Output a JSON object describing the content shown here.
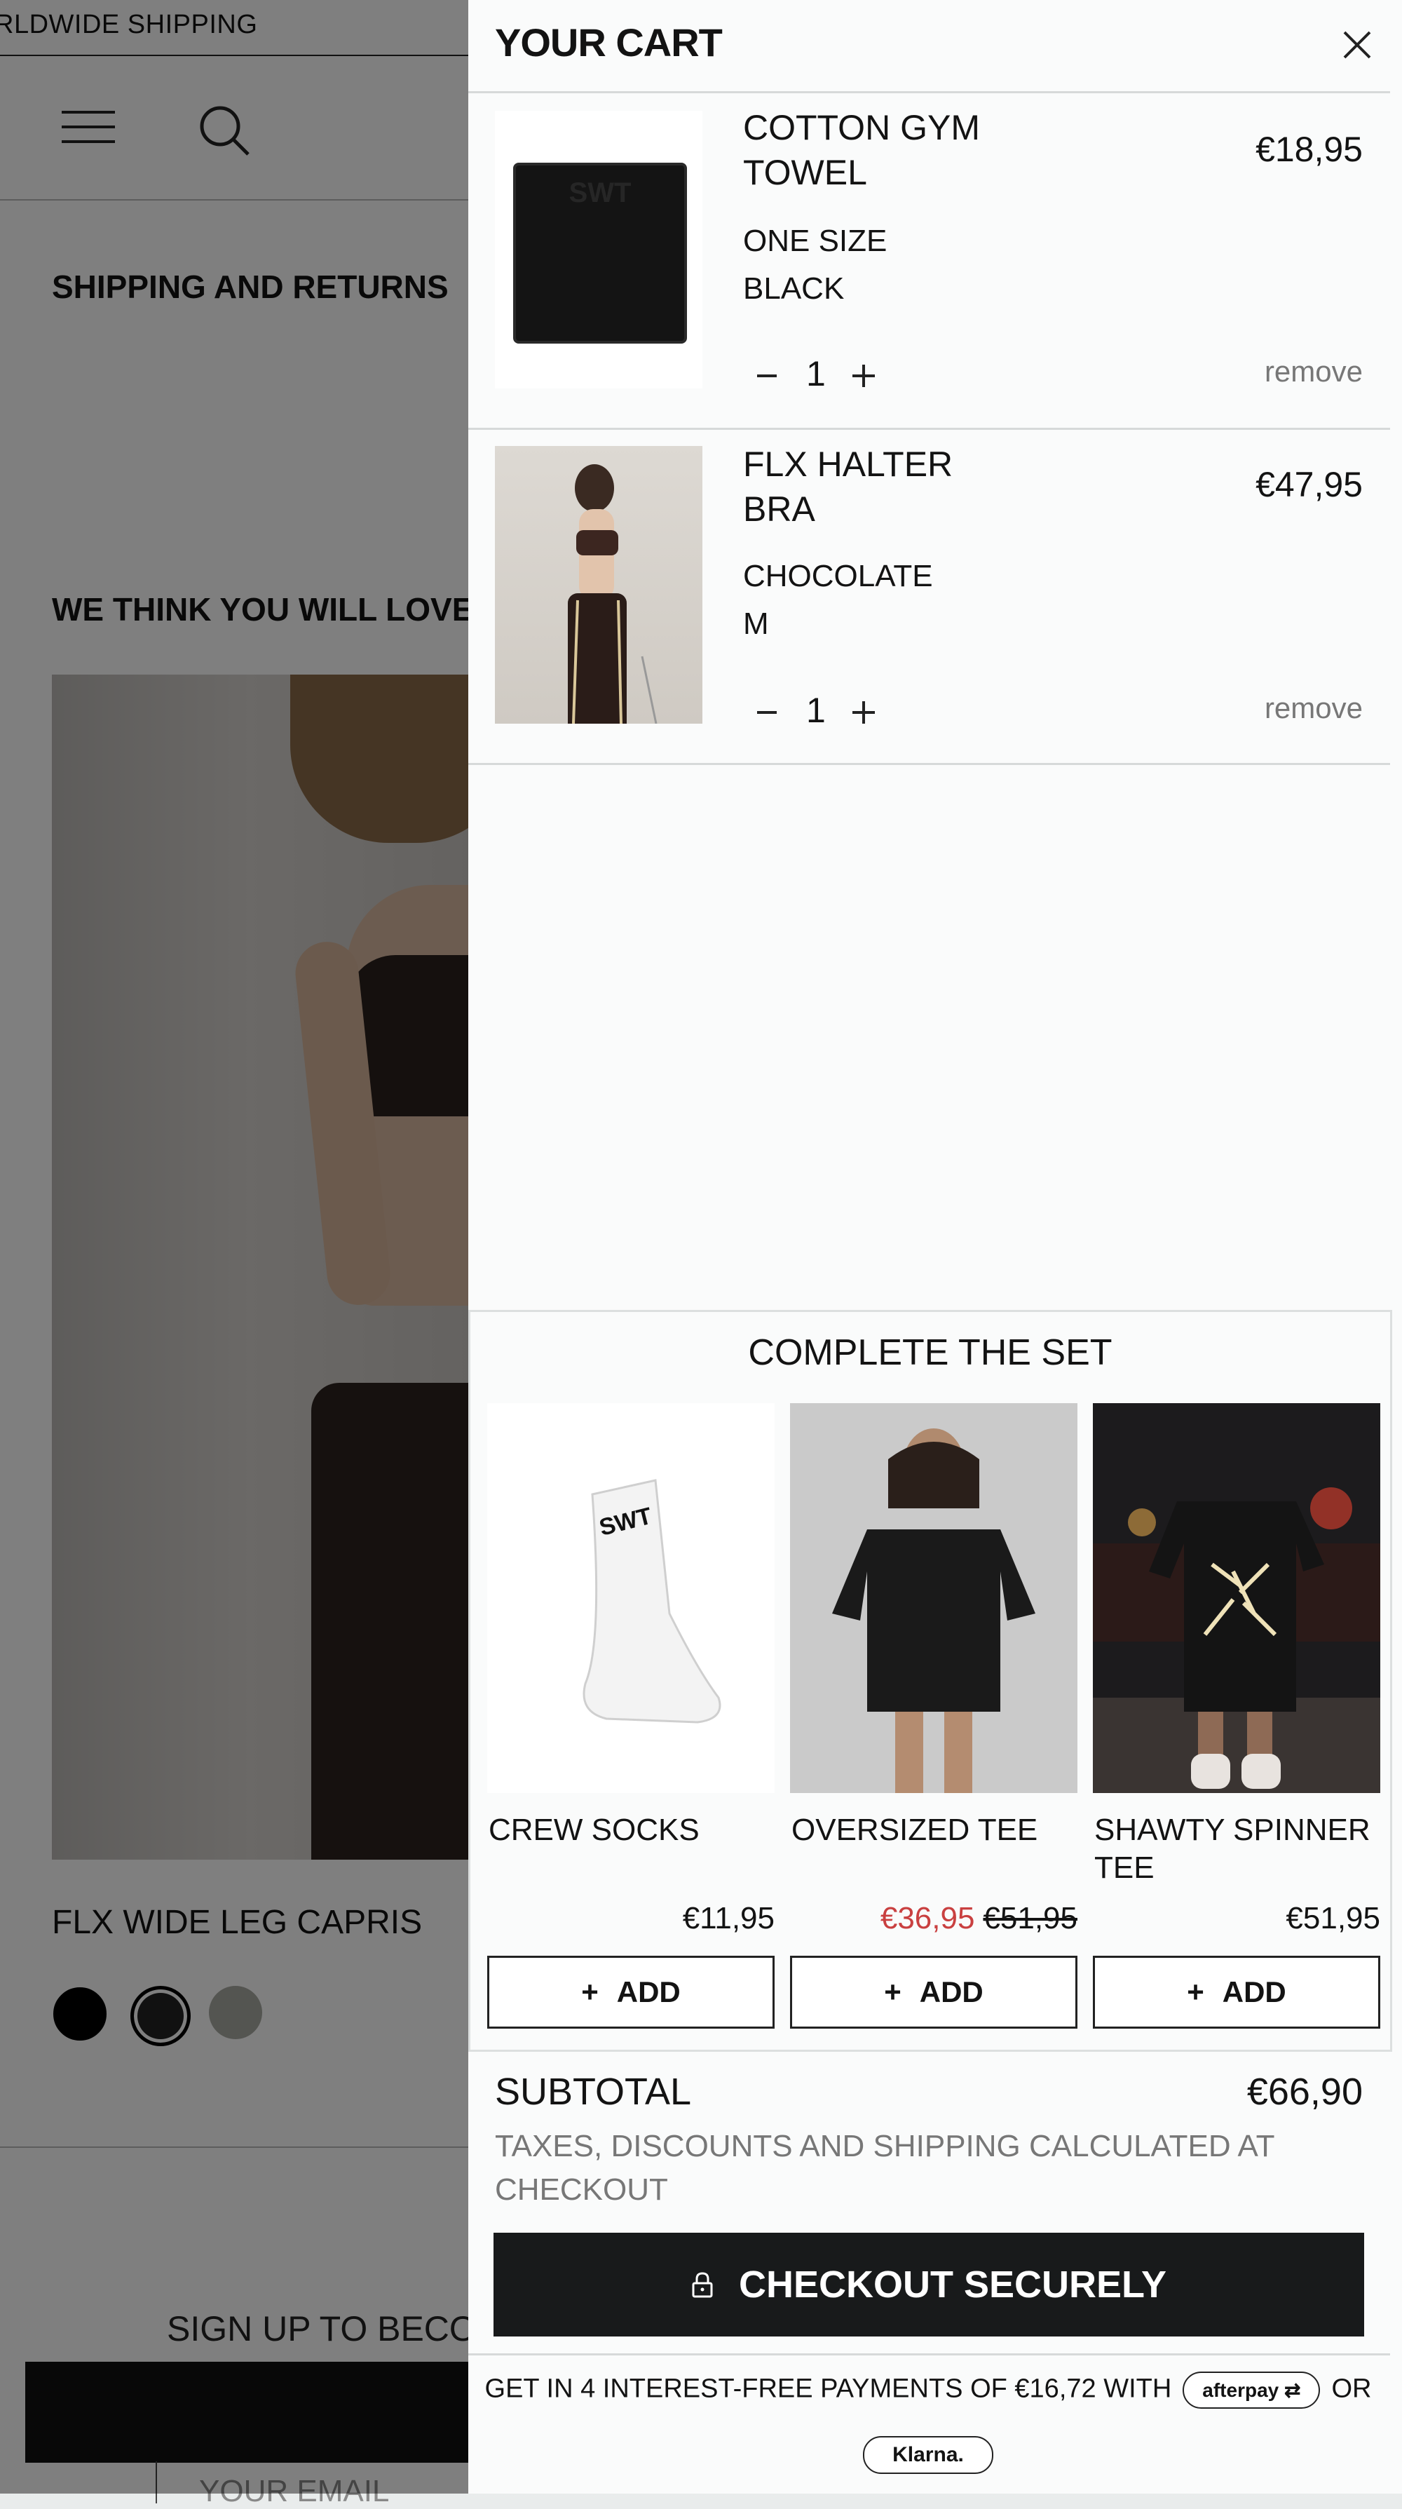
{
  "background": {
    "shipping_banner": "RLDWIDE SHIPPING",
    "section_shipping": "SHIPPING AND RETURNS",
    "section_recommend": "WE THINK YOU WILL LOVE",
    "product_title": "FLX WIDE LEG CAPRIS",
    "swatches": [
      "#000000",
      "#222222",
      "#a9aaa3"
    ],
    "signup_text": "SIGN UP TO BECO",
    "email_placeholder": "YOUR EMAIL"
  },
  "cart": {
    "title": "YOUR CART",
    "close_icon": "close-icon",
    "items": [
      {
        "name": "COTTON GYM TOWEL",
        "size": "ONE SIZE",
        "color": "BLACK",
        "price": "€18,95",
        "qty": "1",
        "remove": "remove"
      },
      {
        "name": "FLX HALTER BRA",
        "size": "CHOCOLATE",
        "color": "M",
        "price": "€47,95",
        "qty": "1",
        "remove": "remove"
      }
    ],
    "complete_set": {
      "title": "COMPLETE THE SET",
      "products": [
        {
          "name": "CREW SOCKS",
          "price": "€11,95",
          "sale_price": "",
          "was_price": "",
          "add": "ADD"
        },
        {
          "name": "OVERSIZED TEE",
          "price": "",
          "sale_price": "€36,95",
          "was_price": "€51,95",
          "add": "ADD"
        },
        {
          "name": "SHAWTY SPINNER TEE",
          "price": "€51,95",
          "sale_price": "",
          "was_price": "",
          "add": "ADD"
        }
      ]
    },
    "subtotal_label": "SUBTOTAL",
    "subtotal_value": "€66,90",
    "tax_note": "TAXES, DISCOUNTS AND SHIPPING CALCULATED AT CHECKOUT",
    "checkout_label": "CHECKOUT SECURELY",
    "pay_text": "GET IN 4 INTEREST-FREE PAYMENTS OF €16,72 WITH",
    "afterpay": "afterpay",
    "or": "OR",
    "klarna": "Klarna."
  },
  "colors": {
    "sale": "#c94040",
    "button_dark": "#181a1b",
    "drawer_bg": "#fafbfb"
  }
}
